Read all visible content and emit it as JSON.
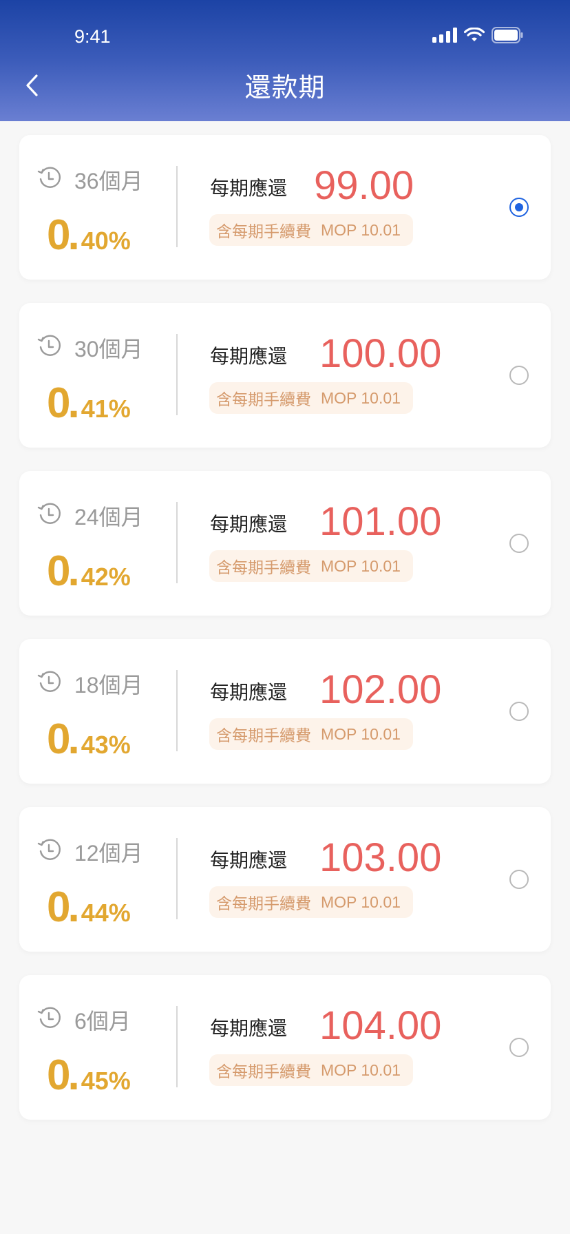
{
  "status": {
    "time": "9:41"
  },
  "header": {
    "title": "還款期",
    "back_icon": "chevron-left-icon"
  },
  "colors": {
    "accent": "#1f63e0",
    "rate": "#e2a730",
    "amount": "#e8615d",
    "fee_text": "#d59a6c",
    "header_top": "#1c43a5",
    "header_bottom": "#6a7fd2"
  },
  "plans": [
    {
      "months": "36個月",
      "rate_int": "0",
      "rate_frac": "40%",
      "per_label": "每期應還",
      "amount": "99.00",
      "fee_label": "含每期手續費",
      "fee_value": "MOP 10.01",
      "selected": true
    },
    {
      "months": "30個月",
      "rate_int": "0",
      "rate_frac": "41%",
      "per_label": "每期應還",
      "amount": "100.00",
      "fee_label": "含每期手續費",
      "fee_value": "MOP 10.01",
      "selected": false
    },
    {
      "months": "24個月",
      "rate_int": "0",
      "rate_frac": "42%",
      "per_label": "每期應還",
      "amount": "101.00",
      "fee_label": "含每期手續費",
      "fee_value": "MOP 10.01",
      "selected": false
    },
    {
      "months": "18個月",
      "rate_int": "0",
      "rate_frac": "43%",
      "per_label": "每期應還",
      "amount": "102.00",
      "fee_label": "含每期手續費",
      "fee_value": "MOP 10.01",
      "selected": false
    },
    {
      "months": "12個月",
      "rate_int": "0",
      "rate_frac": "44%",
      "per_label": "每期應還",
      "amount": "103.00",
      "fee_label": "含每期手續費",
      "fee_value": "MOP 10.01",
      "selected": false
    },
    {
      "months": "6個月",
      "rate_int": "0",
      "rate_frac": "45%",
      "per_label": "每期應還",
      "amount": "104.00",
      "fee_label": "含每期手續費",
      "fee_value": "MOP 10.01",
      "selected": false
    }
  ]
}
